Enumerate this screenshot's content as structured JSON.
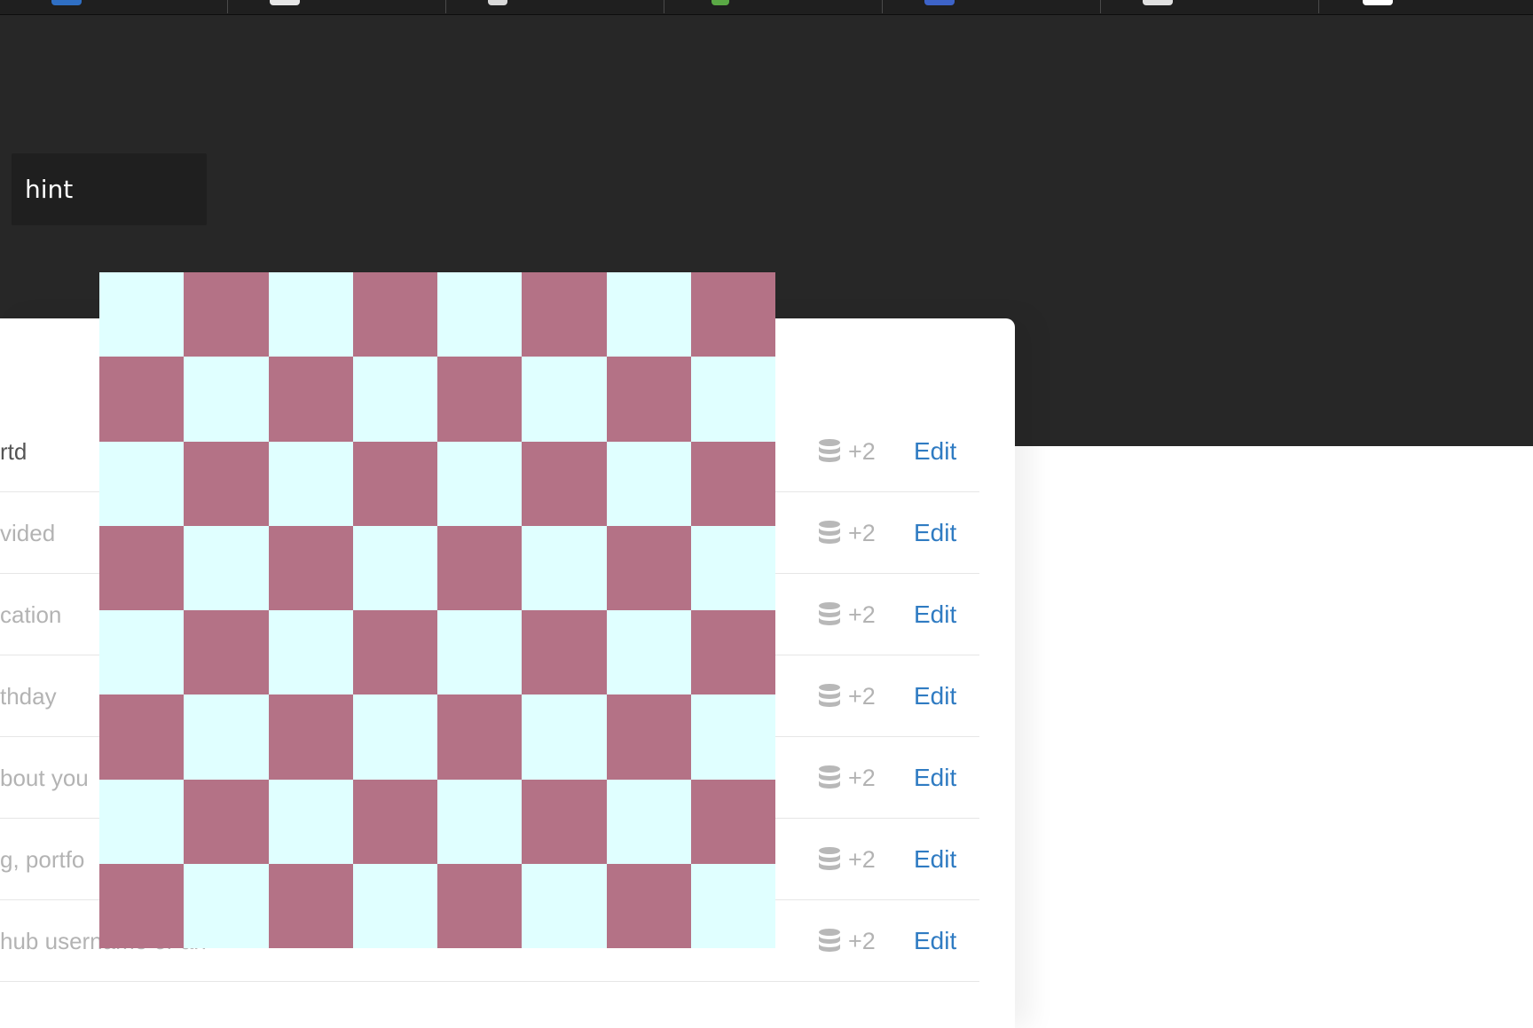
{
  "hint": {
    "text": "hint"
  },
  "rows": [
    {
      "label": "rtd",
      "count": "+2",
      "edit": "Edit"
    },
    {
      "label": "vided",
      "count": "+2",
      "edit": "Edit"
    },
    {
      "label": "cation",
      "count": "+2",
      "edit": "Edit"
    },
    {
      "label": "thday",
      "count": "+2",
      "edit": "Edit"
    },
    {
      "label": "bout you",
      "count": "+2",
      "edit": "Edit"
    },
    {
      "label": "g, portfo",
      "count": "+2",
      "edit": "Edit"
    },
    {
      "label": "hub username or an",
      "count": "+2",
      "edit": "Edit"
    }
  ],
  "overlay": {
    "colors": {
      "light": "#e0ffff",
      "dark": "#b47286"
    }
  },
  "colors": {
    "dark_background": "#272727",
    "link": "#2f7bc2",
    "muted_text": "#b3b3b3"
  }
}
